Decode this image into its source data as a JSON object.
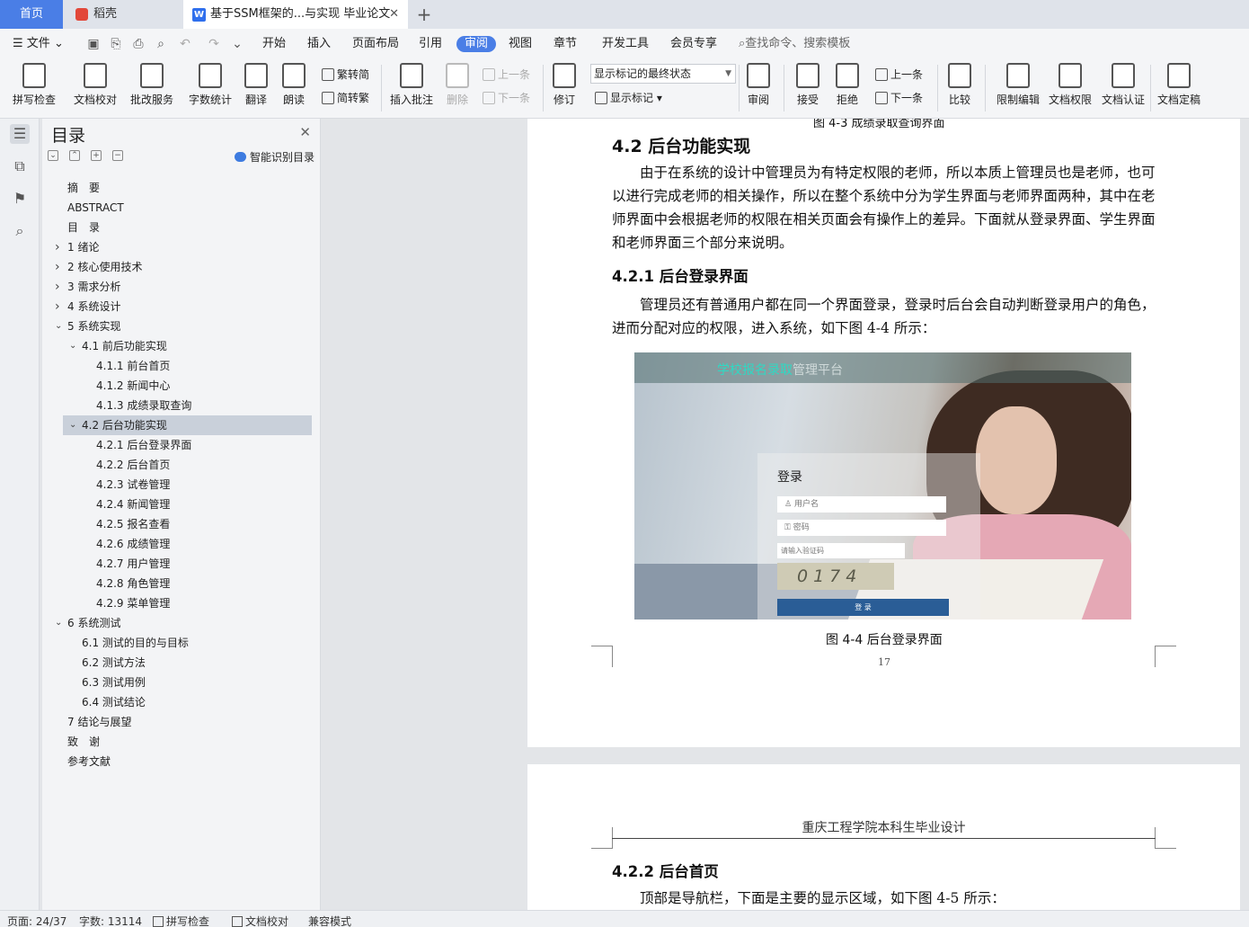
{
  "tabs": {
    "home": "首页",
    "daoke": "稻壳",
    "doc": "基于SSM框架的...与实现 毕业论文",
    "close": "✕",
    "plus": "+"
  },
  "menu": {
    "file": "文件",
    "items": [
      "开始",
      "插入",
      "页面布局",
      "引用",
      "审阅",
      "视图",
      "章节",
      "开发工具",
      "会员专享"
    ],
    "active": "审阅",
    "search": "查找命令、搜索模板"
  },
  "ribbon": {
    "spell": "拼写检查",
    "proofread": "文档校对",
    "correction": "批改服务",
    "wordcount": "字数统计",
    "translate": "翻译",
    "read": "朗读",
    "to_traditional": "繁转简",
    "to_simplified": "简转繁",
    "insert_comment": "插入批注",
    "delete": "删除",
    "prev": "上一条",
    "next": "下一条",
    "track": "修订",
    "markup_state": "显示标记的最终状态",
    "show_markup": "显示标记",
    "review": "审阅",
    "accept": "接受",
    "reject": "拒绝",
    "prev2": "上一条",
    "next2": "下一条",
    "compare": "比较",
    "restrict": "限制编辑",
    "permission": "文档权限",
    "certify": "文档认证",
    "finalize": "文档定稿"
  },
  "toc": {
    "title": "目录",
    "smart": "智能识别目录",
    "items": [
      {
        "label": "摘　要",
        "level": 0,
        "arrow": ""
      },
      {
        "label": "ABSTRACT",
        "level": 0,
        "arrow": ""
      },
      {
        "label": "目　录",
        "level": 0,
        "arrow": ""
      },
      {
        "label": "1  绪论",
        "level": 0,
        "arrow": ">"
      },
      {
        "label": "2  核心使用技术",
        "level": 0,
        "arrow": ">"
      },
      {
        "label": "3  需求分析",
        "level": 0,
        "arrow": ">"
      },
      {
        "label": "4  系统设计",
        "level": 0,
        "arrow": ">"
      },
      {
        "label": "5  系统实现",
        "level": 0,
        "arrow": "v"
      },
      {
        "label": "4.1  前后功能实现",
        "level": 1,
        "arrow": "v"
      },
      {
        "label": "4.1.1  前台首页",
        "level": 2,
        "arrow": ""
      },
      {
        "label": "4.1.2  新闻中心",
        "level": 2,
        "arrow": ""
      },
      {
        "label": "4.1.3  成绩录取查询",
        "level": 2,
        "arrow": ""
      },
      {
        "label": "4.2  后台功能实现",
        "level": 1,
        "arrow": "v",
        "selected": true
      },
      {
        "label": "4.2.1  后台登录界面",
        "level": 2,
        "arrow": ""
      },
      {
        "label": "4.2.2  后台首页",
        "level": 2,
        "arrow": ""
      },
      {
        "label": "4.2.3  试卷管理",
        "level": 2,
        "arrow": ""
      },
      {
        "label": "4.2.4  新闻管理",
        "level": 2,
        "arrow": ""
      },
      {
        "label": "4.2.5  报名查看",
        "level": 2,
        "arrow": ""
      },
      {
        "label": "4.2.6  成绩管理",
        "level": 2,
        "arrow": ""
      },
      {
        "label": "4.2.7  用户管理",
        "level": 2,
        "arrow": ""
      },
      {
        "label": "4.2.8  角色管理",
        "level": 2,
        "arrow": ""
      },
      {
        "label": "4.2.9  菜单管理",
        "level": 2,
        "arrow": ""
      },
      {
        "label": "6  系统测试",
        "level": 0,
        "arrow": "v"
      },
      {
        "label": "6.1  测试的目的与目标",
        "level": 1,
        "arrow": ""
      },
      {
        "label": "6.2  测试方法",
        "level": 1,
        "arrow": ""
      },
      {
        "label": "6.3  测试用例",
        "level": 1,
        "arrow": ""
      },
      {
        "label": "6.4  测试结论",
        "level": 1,
        "arrow": ""
      },
      {
        "label": "7  结论与展望",
        "level": 0,
        "arrow": ""
      },
      {
        "label": "致　谢",
        "level": 0,
        "arrow": ""
      },
      {
        "label": "参考文献",
        "level": 0,
        "arrow": ""
      }
    ]
  },
  "doc": {
    "prev_caption": "图 4-3  成绩录取查询界面",
    "h42": "4.2  后台功能实现",
    "p1": "由于在系统的设计中管理员为有特定权限的老师，所以本质上管理员也是老师，也可以进行完成老师的相关操作，所以在整个系统中分为学生界面与老师界面两种，其中在老师界面中会根据老师的权限在相关页面会有操作上的差异。下面就从登录界面、学生界面和老师界面三个部分来说明。",
    "h421": "4.2.1  后台登录界面",
    "p2": "管理员还有普通用户都在同一个界面登录，登录时后台会自动判断登录用户的角色，进而分配对应的权限，进入系统，如下图 4-4 所示：",
    "fig_title_a": "学校报名录取",
    "fig_title_b": "管理平台",
    "login_title": "登录",
    "login_user": "用户名",
    "login_pass": "密码",
    "login_captcha": "请输入验证码",
    "captcha_text": "0174",
    "login_btn": "登 录",
    "caption": "图 4-4  后台登录界面",
    "page_num": "17",
    "header2": "重庆工程学院本科生毕业设计",
    "h422": "4.2.2  后台首页",
    "p3": "顶部是导航栏，下面是主要的显示区域，如下图 4-5 所示："
  },
  "status": {
    "page": "页面: 24/37",
    "words": "字数: 13114",
    "spell": "拼写检查",
    "proof": "文档校对",
    "compat": "兼容模式"
  }
}
